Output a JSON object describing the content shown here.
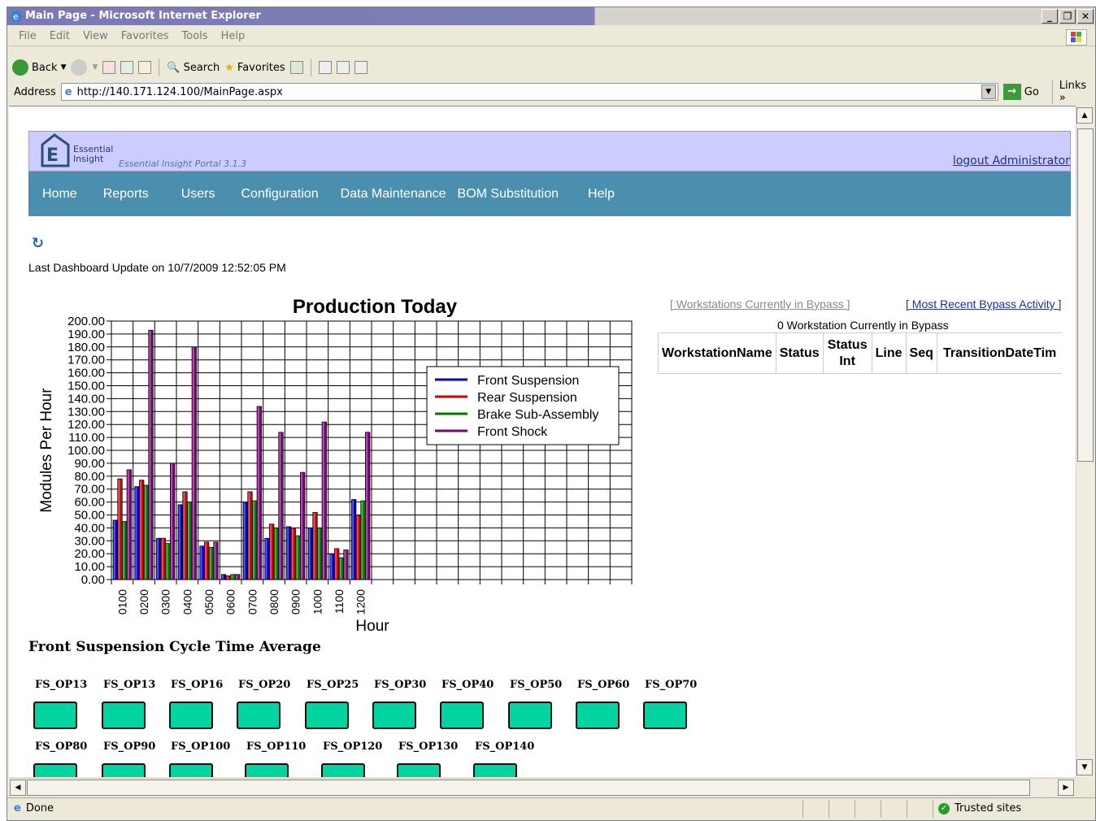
{
  "window": {
    "title": "Main Page - Microsoft Internet Explorer"
  },
  "menu": [
    "File",
    "Edit",
    "View",
    "Favorites",
    "Tools",
    "Help"
  ],
  "toolbar": {
    "back": "Back",
    "search": "Search",
    "favorites": "Favorites"
  },
  "address": {
    "label": "Address",
    "url": "http://140.171.124.100/MainPage.aspx",
    "go": "Go",
    "links": "Links"
  },
  "status": {
    "text": "Done",
    "zone": "Trusted sites"
  },
  "page": {
    "brand_line1": "Essential",
    "brand_line2": "Insight",
    "portal_name": "Essential Insight Portal 3.1.3",
    "logout": "logout Administrator",
    "nav": [
      "Home",
      "Reports",
      "Users",
      "Configuration",
      "Data Maintenance",
      "BOM Substitution",
      "Help"
    ],
    "last_update": "Last Dashboard Update on 10/7/2009 12:52:05 PM",
    "bypass_link1": "[ Workstations Currently in Bypass ]",
    "bypass_link2": "[ Most Recent Bypass Activity ]",
    "bypass_count": "0 Workstation Currently in Bypass",
    "bypass_columns": [
      "WorkstationName",
      "Status",
      "Status Int",
      "Line",
      "Seq",
      "TransitionDateTim"
    ],
    "section_title": "Front Suspension Cycle Time Average",
    "ops_row1": [
      "FS_OP13",
      "FS_OP13",
      "FS_OP16",
      "FS_OP20",
      "FS_OP25",
      "FS_OP30",
      "FS_OP40",
      "FS_OP50",
      "FS_OP60",
      "FS_OP70"
    ],
    "ops_row2": [
      "FS_OP80",
      "FS_OP90",
      "FS_OP100",
      "FS_OP110",
      "FS_OP120",
      "FS_OP130",
      "FS_OP140"
    ],
    "colors": {
      "banner": "#ccccff",
      "nav": "#4a8fae",
      "op_box": "#00d4a0"
    }
  },
  "chart_data": {
    "type": "bar",
    "title": "Production Today",
    "xlabel": "Hour",
    "ylabel": "Modules Per Hour",
    "ylim": [
      0,
      200
    ],
    "y_ticks": [
      "0.00",
      "10.00",
      "20.00",
      "30.00",
      "40.00",
      "50.00",
      "60.00",
      "70.00",
      "80.00",
      "90.00",
      "100.00",
      "110.00",
      "120.00",
      "130.00",
      "140.00",
      "150.00",
      "160.00",
      "170.00",
      "180.00",
      "190.00",
      "200.00"
    ],
    "categories": [
      "0100",
      "0200",
      "0300",
      "0400",
      "0500",
      "0600",
      "0700",
      "0800",
      "0900",
      "1000",
      "1100",
      "1200"
    ],
    "total_slots": 24,
    "legend_position": "top-right",
    "series": [
      {
        "name": "Front Suspension",
        "color": "#0000cc",
        "values": [
          46,
          72,
          32,
          58,
          26,
          4,
          60,
          32,
          41,
          40,
          20,
          62
        ]
      },
      {
        "name": "Rear Suspension",
        "color": "#cc0000",
        "values": [
          78,
          77,
          32,
          68,
          29,
          3,
          68,
          43,
          40,
          52,
          24,
          50
        ]
      },
      {
        "name": "Brake Sub-Assembly",
        "color": "#007700",
        "values": [
          45,
          73,
          28,
          60,
          25,
          4,
          61,
          40,
          34,
          40,
          17,
          61
        ]
      },
      {
        "name": "Front Shock",
        "color": "#7a0077",
        "values": [
          85,
          193,
          90,
          180,
          29,
          4,
          134,
          114,
          83,
          122,
          23,
          114
        ]
      }
    ]
  }
}
